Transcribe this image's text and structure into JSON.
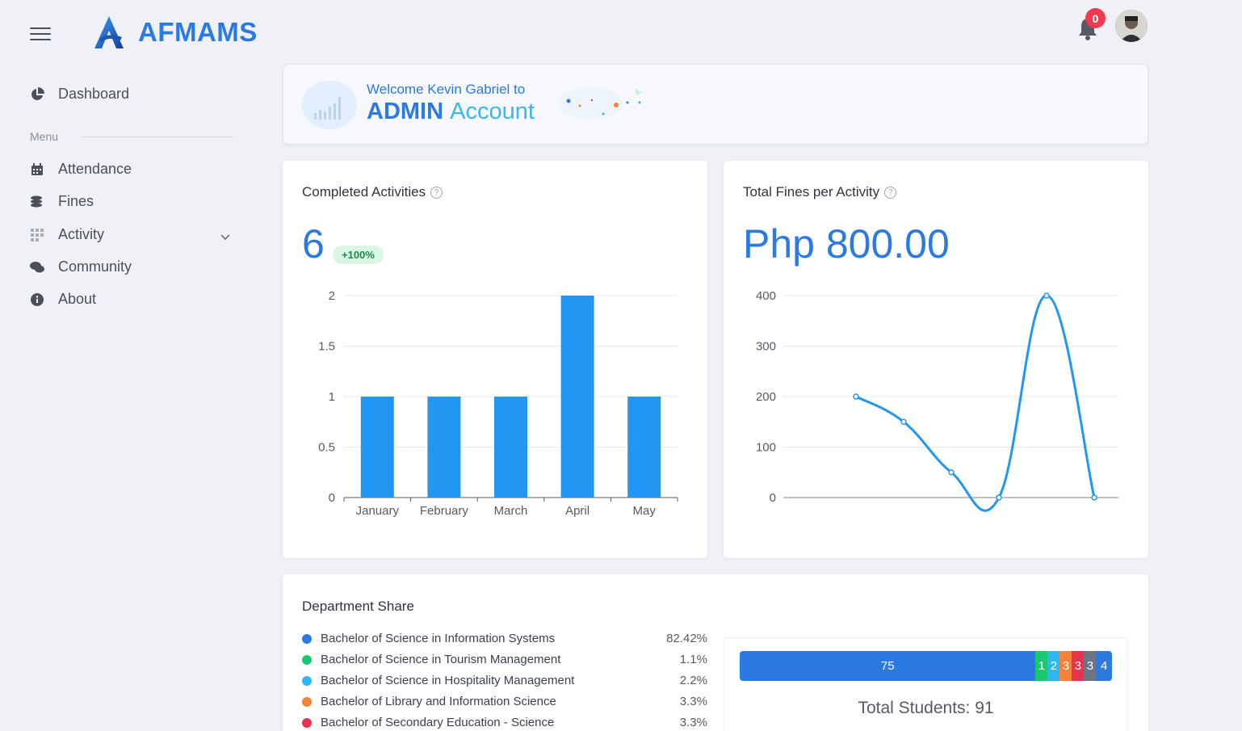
{
  "header": {
    "app_name": "AFMAMS",
    "notification_count": "0"
  },
  "sidebar": {
    "dashboard": "Dashboard",
    "menu_label": "Menu",
    "items": [
      {
        "label": "Attendance",
        "icon": "calendar-icon"
      },
      {
        "label": "Fines",
        "icon": "coins-icon"
      },
      {
        "label": "Activity",
        "icon": "grid-icon"
      },
      {
        "label": "Community",
        "icon": "comments-icon"
      },
      {
        "label": "About",
        "icon": "info-icon"
      }
    ]
  },
  "welcome": {
    "line1": "Welcome Kevin Gabriel to",
    "admin": "ADMIN",
    "account": "Account"
  },
  "completed": {
    "title": "Completed Activities",
    "value": "6",
    "change": "+100%",
    "chart_data": {
      "type": "bar",
      "categories": [
        "January",
        "February",
        "March",
        "April",
        "May"
      ],
      "values": [
        1,
        1,
        1,
        2,
        1
      ],
      "ylim": [
        0,
        2
      ],
      "yticks": [
        "0",
        "0.5",
        "1",
        "1.5",
        "2"
      ],
      "color": "#2196f3"
    }
  },
  "fines": {
    "title": "Total Fines per Activity",
    "value": "Php 800.00",
    "chart_data": {
      "type": "line",
      "values": [
        200,
        150,
        50,
        0,
        400,
        0
      ],
      "ylim": [
        0,
        400
      ],
      "yticks": [
        "0",
        "100",
        "200",
        "300",
        "400"
      ],
      "color": "#2196f3"
    }
  },
  "department": {
    "title": "Department Share",
    "rows": [
      {
        "name": "Bachelor of Science in Information Systems",
        "pct": "82.42%",
        "color": "#2b7ae4"
      },
      {
        "name": "Bachelor of Science in Tourism Management",
        "pct": "1.1%",
        "color": "#18c96e"
      },
      {
        "name": "Bachelor of Science in Hospitality Management",
        "pct": "2.2%",
        "color": "#2fb8f0"
      },
      {
        "name": "Bachelor of Library and Information Science",
        "pct": "3.3%",
        "color": "#f5823a"
      },
      {
        "name": "Bachelor of Secondary Education - Science",
        "pct": "3.3%",
        "color": "#e8334f"
      }
    ],
    "segments": [
      {
        "label": "75",
        "value": 75,
        "color": "#2b7ae4"
      },
      {
        "label": "1",
        "value": 1,
        "color": "#18c96e"
      },
      {
        "label": "2",
        "value": 2,
        "color": "#2fb8f0"
      },
      {
        "label": "3",
        "value": 3,
        "color": "#f5823a"
      },
      {
        "label": "3",
        "value": 3,
        "color": "#e8334f"
      },
      {
        "label": "3",
        "value": 3,
        "color": "#6c7586"
      },
      {
        "label": "4",
        "value": 4,
        "color": "#2b7ae4"
      }
    ],
    "total": "Total Students: 91"
  }
}
